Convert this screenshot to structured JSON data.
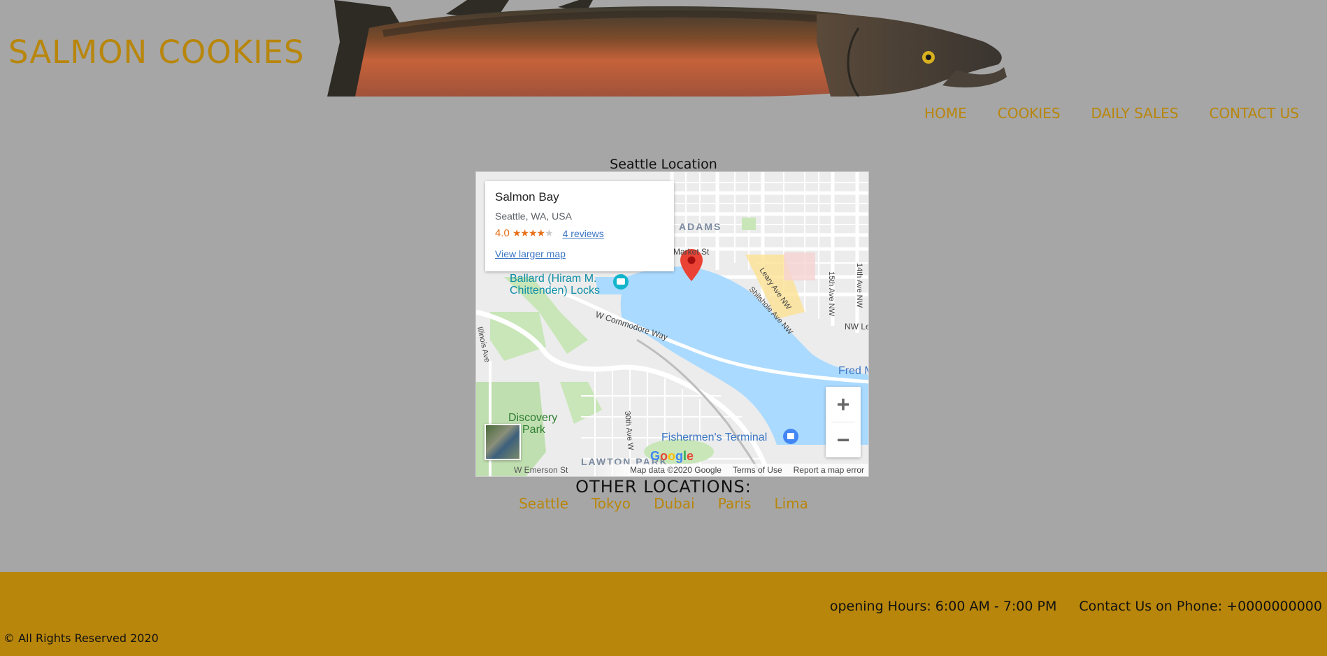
{
  "header": {
    "site_title": "SALMON COOKIES"
  },
  "nav": {
    "items": [
      {
        "label": "HOME"
      },
      {
        "label": "COOKIES"
      },
      {
        "label": "DAILY SALES"
      },
      {
        "label": "CONTACT US"
      }
    ]
  },
  "map_section": {
    "caption": "Seattle Location",
    "info_card": {
      "place": "Salmon Bay",
      "address": "Seattle, WA, USA",
      "rating": "4.0",
      "stars_filled": "★★★★",
      "stars_empty": "★",
      "reviews": "4 reviews",
      "larger_map_link": "View larger map"
    },
    "map_labels": {
      "adams": "ADAMS",
      "market_st": "Market St",
      "locks_line1": "Ballard (Hiram M.",
      "locks_line2": "Chittenden) Locks",
      "leary": "Leary Ave NW",
      "shilshole": "Shilshole Ave NW",
      "15th": "15th Ave NW",
      "14th": "14th Ave NW",
      "nw_le": "NW Le",
      "commodore": "W Commodore Way",
      "illinois": "Illinois Ave",
      "fred": "Fred M",
      "discovery1": "Discovery",
      "discovery2": "Park",
      "30th": "30th Ave W",
      "fishermens": "Fishermen's Terminal",
      "lawton": "LAWTON PARK",
      "emerson": "W Emerson St"
    },
    "zoom_in": "+",
    "zoom_out": "−",
    "google": "Google",
    "footer": {
      "map_data": "Map data ©2020 Google",
      "terms": "Terms of Use",
      "report": "Report a map error"
    }
  },
  "other_locations": {
    "title": "OTHER LOCATIONS:",
    "items": [
      {
        "label": "Seattle"
      },
      {
        "label": "Tokyo"
      },
      {
        "label": "Dubai"
      },
      {
        "label": "Paris"
      },
      {
        "label": "Lima"
      }
    ]
  },
  "footer": {
    "hours": "opening Hours: 6:00 AM - 7:00 PM",
    "phone": "Contact Us on Phone: +0000000000",
    "copyright": "© All Rights Reserved 2020"
  },
  "colors": {
    "background": "#a6a6a6",
    "accent": "#b8860b",
    "water": "#aadaff",
    "park": "#c0dfb0"
  }
}
